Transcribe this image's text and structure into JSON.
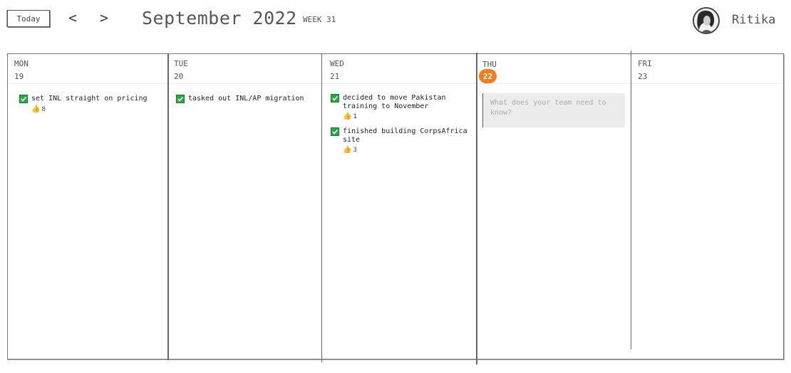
{
  "header": {
    "today_label": "Today",
    "prev_label": "<",
    "next_label": ">",
    "month_title": "September 2022",
    "week_label": "WEEK 31",
    "user_name": "Ritika"
  },
  "days": [
    {
      "name": "MON",
      "number": "19",
      "is_today": false,
      "items": [
        {
          "text": "set INL straight on pricing",
          "likes": "8"
        }
      ]
    },
    {
      "name": "TUE",
      "number": "20",
      "is_today": false,
      "items": [
        {
          "text": "tasked out INL/AP migration",
          "likes": ""
        }
      ]
    },
    {
      "name": "WED",
      "number": "21",
      "is_today": false,
      "items": [
        {
          "text": "decided to move Pakistan training to November",
          "likes": "1"
        },
        {
          "text": "finished building CorpsAfrica site",
          "likes": "3"
        }
      ]
    },
    {
      "name": "THU",
      "number": "22",
      "is_today": true,
      "input_placeholder": "What does your team need to know?"
    },
    {
      "name": "FRI",
      "number": "23",
      "is_today": false
    }
  ],
  "colors": {
    "today_accent": "#f57c1f",
    "check_green": "#29a845",
    "input_bg": "#ececec"
  },
  "icons": {
    "check": "checkbox-checked-icon",
    "like": "thumbs-up-icon",
    "prev": "chevron-left-icon",
    "next": "chevron-right-icon"
  }
}
